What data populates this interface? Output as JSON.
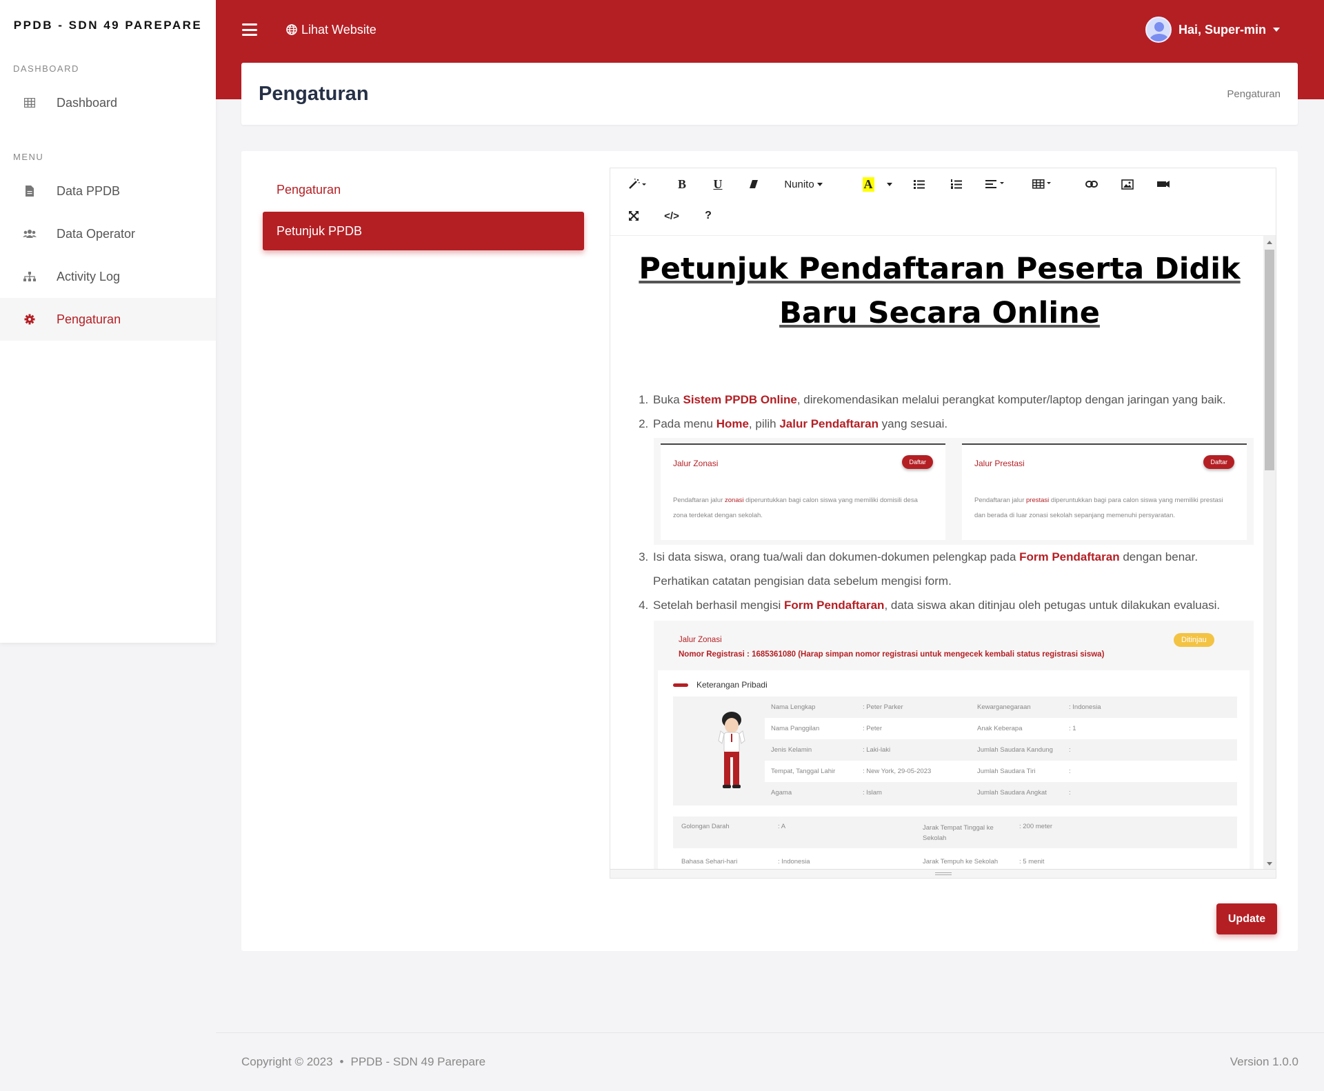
{
  "sidebar": {
    "brand": "PPDB - SDN 49 PAREPARE",
    "section_dashboard": "DASHBOARD",
    "section_menu": "MENU",
    "items": [
      {
        "label": "Dashboard",
        "icon": "table-icon"
      },
      {
        "label": "Data PPDB",
        "icon": "file-icon"
      },
      {
        "label": "Data Operator",
        "icon": "users-icon"
      },
      {
        "label": "Activity Log",
        "icon": "sitemap-icon"
      },
      {
        "label": "Pengaturan",
        "icon": "gear-icon",
        "active": true
      }
    ]
  },
  "topnav": {
    "view_website": "Lihat Website",
    "greeting": "Hai, Super-min"
  },
  "page": {
    "title": "Pengaturan",
    "breadcrumb": "Pengaturan"
  },
  "tabs": {
    "header": "Pengaturan",
    "active": "Petunjuk PPDB"
  },
  "toolbar": {
    "font_name": "Nunito",
    "bold": "B",
    "underline": "U",
    "code": "</>",
    "help": "?",
    "highlight": "A"
  },
  "document": {
    "title": "Petunjuk Pendaftaran Peserta Didik Baru Secara Online",
    "steps": [
      {
        "pre": "Buka ",
        "b1": "Sistem PPDB Online",
        "mid": ", direkomendasikan melalui perangkat komputer/laptop dengan jaringan yang baik.",
        "b2": "",
        "post": ""
      },
      {
        "pre": "Pada menu ",
        "b1": "Home",
        "mid": ", pilih ",
        "b2": "Jalur Pendaftaran",
        "post": " yang sesuai."
      },
      {
        "pre": "Isi data siswa, orang tua/wali dan dokumen-dokumen pelengkap pada ",
        "b1": "Form Pendaftaran",
        "mid": " dengan benar. Perhatikan catatan pengisian data sebelum mengisi form.",
        "b2": "",
        "post": ""
      },
      {
        "pre": "Setelah berhasil mengisi ",
        "b1": "Form Pendaftaran",
        "mid": ", data siswa akan ditinjau oleh petugas untuk dilakukan evaluasi.",
        "b2": "",
        "post": ""
      }
    ],
    "jalur_cards": [
      {
        "title": "Jalur Zonasi",
        "button": "Daftar",
        "desc_pre": "Pendaftaran jalur ",
        "desc_b": "zonasi",
        "desc_post": " diperuntukkan bagi calon siswa yang memiliki domisili desa zona terdekat dengan sekolah."
      },
      {
        "title": "Jalur Prestasi",
        "button": "Daftar",
        "desc_pre": "Pendaftaran jalur ",
        "desc_b": "prestasi",
        "desc_post": " diperuntukkan bagi para calon siswa yang memiliki prestasi dan berada di luar zonasi sekolah sepanjang memenuhi persyaratan."
      }
    ],
    "registration": {
      "jalur": "Jalur Zonasi",
      "nomor": "Nomor Registrasi : 1685361080 (Harap simpan nomor registrasi untuk mengecek kembali status registrasi siswa)",
      "status": "Ditinjau",
      "section": "Keterangan Pribadi",
      "rows": [
        {
          "l1": "Nama Lengkap",
          "v1": ": Peter Parker",
          "l2": "Kewarganegaraan",
          "v2": ": Indonesia"
        },
        {
          "l1": "Nama Panggilan",
          "v1": ": Peter",
          "l2": "Anak Keberapa",
          "v2": ": 1"
        },
        {
          "l1": "Jenis Kelamin",
          "v1": ": Laki-laki",
          "l2": "Jumlah Saudara Kandung",
          "v2": ":"
        },
        {
          "l1": "Tempat, Tanggal Lahir",
          "v1": ": New York, 29-05-2023",
          "l2": "Jumlah Saudara Tiri",
          "v2": ":"
        },
        {
          "l1": "Agama",
          "v1": ": Islam",
          "l2": "Jumlah Saudara Angkat",
          "v2": ":"
        }
      ],
      "bottom_rows": [
        {
          "l1": "Golongan Darah",
          "v1": ": A",
          "l2": "Jarak Tempat Tinggal ke Sekolah",
          "v2": ": 200 meter"
        },
        {
          "l1": "Bahasa Sehari-hari",
          "v1": ": Indonesia",
          "l2": "Jarak Tempuh ke Sekolah",
          "v2": ": 5 menit"
        }
      ]
    }
  },
  "actions": {
    "update": "Update"
  },
  "footer": {
    "copyright": "Copyright © 2023",
    "dot": "•",
    "app": "PPDB - SDN 49 Parepare",
    "version": "Version 1.0.0"
  },
  "colors": {
    "primary": "#b41f24",
    "badge_warning": "#f3c343"
  }
}
